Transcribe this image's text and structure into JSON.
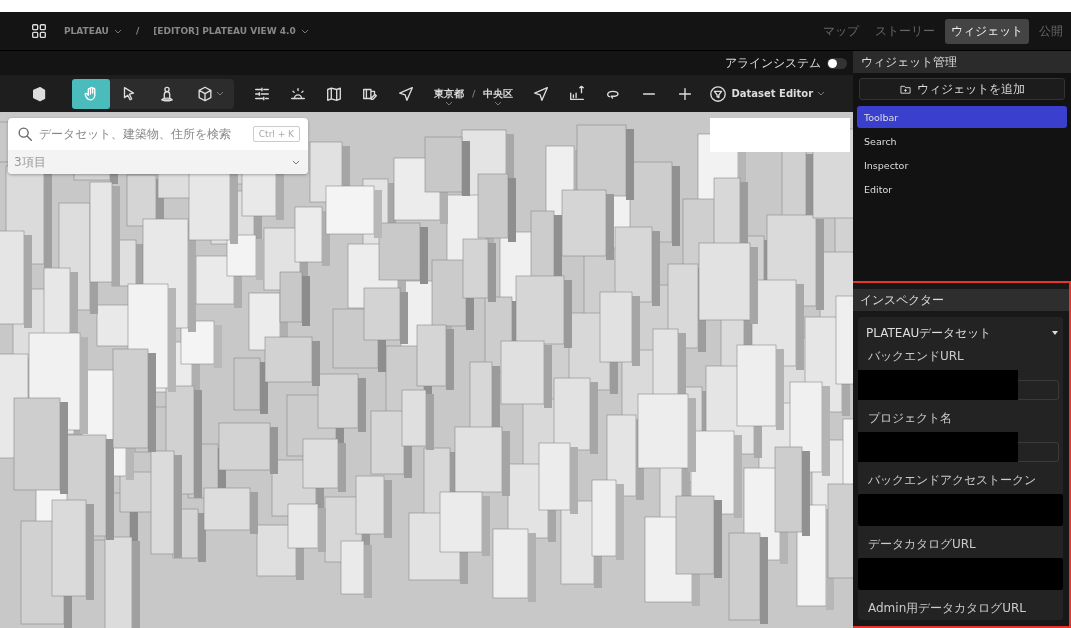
{
  "header": {
    "breadcrumbs": [
      "PLATEAU",
      "[EDITOR] PLATEAU VIEW 4.0"
    ],
    "separator": "/",
    "tabs": [
      {
        "label": "マップ",
        "selected": false
      },
      {
        "label": "ストーリー",
        "selected": false
      },
      {
        "label": "ウィジェット",
        "selected": true
      },
      {
        "label": "公開",
        "selected": false
      }
    ]
  },
  "align_system": {
    "label": "アラインシステム",
    "on": false
  },
  "toolbar": {
    "modes": [
      {
        "selected": true
      },
      {
        "selected": false
      },
      {
        "selected": false
      },
      {
        "selected": false
      }
    ],
    "location": [
      "東京都",
      "中央区"
    ],
    "location_separator": "/",
    "dataset_editor": "Dataset Editor"
  },
  "search": {
    "placeholder": "データセット、建築物、住所を検索",
    "shortcut": "Ctrl + K",
    "summary": "3項目"
  },
  "widget_panel": {
    "title": "ウィジェット管理",
    "add_button": "ウィジェットを追加",
    "items": [
      {
        "label": "Toolbar",
        "selected": true
      },
      {
        "label": "Search",
        "selected": false
      },
      {
        "label": "Inspector",
        "selected": false
      },
      {
        "label": "Editor",
        "selected": false
      }
    ]
  },
  "inspector": {
    "title": "インスペクター",
    "highlighted": true,
    "section": "PLATEAUデータセット",
    "fields": [
      {
        "label": "バックエンドURL",
        "kind": "short"
      },
      {
        "label": "プロジェクト名",
        "kind": "short"
      },
      {
        "label": "バックエンドアクセストークン",
        "kind": "wide"
      },
      {
        "label": "データカタログURL",
        "kind": "wide"
      },
      {
        "label": "Admin用データカタログURL",
        "kind": "label-only"
      }
    ]
  }
}
